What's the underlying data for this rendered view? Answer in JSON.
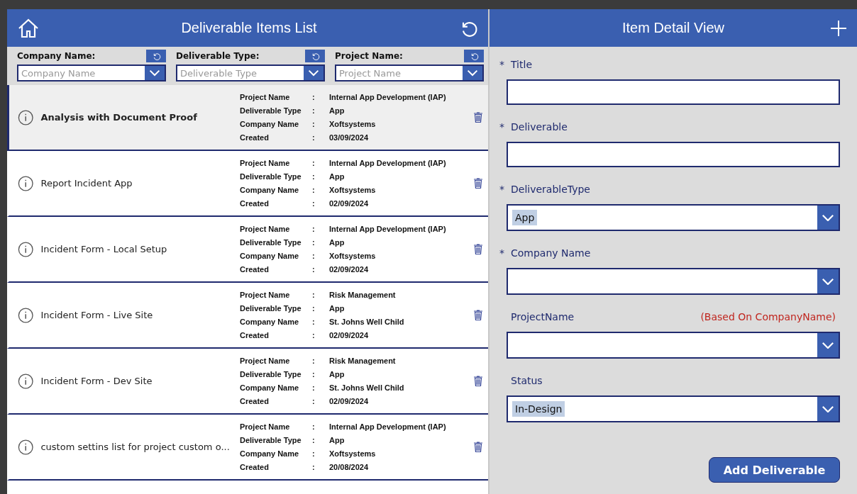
{
  "list_header": {
    "title": "Deliverable Items List"
  },
  "filters": [
    {
      "label": "Company Name:",
      "placeholder": "Company Name"
    },
    {
      "label": "Deliverable Type:",
      "placeholder": "Deliverable Type"
    },
    {
      "label": "Project Name:",
      "placeholder": "Project Name"
    }
  ],
  "items": [
    {
      "title": "Analysis with Document Proof",
      "selected": true,
      "fields": [
        {
          "label": "Project Name",
          "sep": ":",
          "value": "Internal App Development (IAP)"
        },
        {
          "label": "Deliverable Type",
          "sep": ":",
          "value": "App"
        },
        {
          "label": "Company Name",
          "sep": ":",
          "value": "Xoftsystems"
        },
        {
          "label": "Created",
          "sep": ":",
          "value": "03/09/2024"
        }
      ]
    },
    {
      "title": "Report Incident App",
      "selected": false,
      "fields": [
        {
          "label": "Project Name",
          "sep": ":",
          "value": "Internal App Development (IAP)"
        },
        {
          "label": "Deliverable Type",
          "sep": ":",
          "value": "App"
        },
        {
          "label": "Company Name",
          "sep": ":",
          "value": "Xoftsystems"
        },
        {
          "label": "Created",
          "sep": ":",
          "value": "02/09/2024"
        }
      ]
    },
    {
      "title": "Incident Form - Local Setup",
      "selected": false,
      "fields": [
        {
          "label": "Project Name",
          "sep": ":",
          "value": "Internal App Development (IAP)"
        },
        {
          "label": "Deliverable Type",
          "sep": ":",
          "value": "App"
        },
        {
          "label": "Company Name",
          "sep": ":",
          "value": "Xoftsystems"
        },
        {
          "label": "Created",
          "sep": ":",
          "value": "02/09/2024"
        }
      ]
    },
    {
      "title": "Incident Form - Live Site",
      "selected": false,
      "fields": [
        {
          "label": "Project Name",
          "sep": ":",
          "value": "Risk Management"
        },
        {
          "label": "Deliverable Type",
          "sep": ":",
          "value": "App"
        },
        {
          "label": "Company Name",
          "sep": ":",
          "value": "St. Johns Well Child"
        },
        {
          "label": "Created",
          "sep": ":",
          "value": "02/09/2024"
        }
      ]
    },
    {
      "title": "Incident Form - Dev Site",
      "selected": false,
      "fields": [
        {
          "label": "Project Name",
          "sep": ":",
          "value": "Risk Management"
        },
        {
          "label": "Deliverable Type",
          "sep": ":",
          "value": "App"
        },
        {
          "label": "Company Name",
          "sep": ":",
          "value": "St. Johns Well Child"
        },
        {
          "label": "Created",
          "sep": ":",
          "value": "02/09/2024"
        }
      ]
    },
    {
      "title": "custom settins list for project custom o...",
      "selected": false,
      "fields": [
        {
          "label": "Project Name",
          "sep": ":",
          "value": "Internal App Development (IAP)"
        },
        {
          "label": "Deliverable Type",
          "sep": ":",
          "value": "App"
        },
        {
          "label": "Company Name",
          "sep": ":",
          "value": "Xoftsystems"
        },
        {
          "label": "Created",
          "sep": ":",
          "value": "20/08/2024"
        }
      ]
    }
  ],
  "detail_header": {
    "title": "Item Detail View"
  },
  "form": [
    {
      "kind": "text",
      "marker": "*",
      "label": "Title"
    },
    {
      "kind": "text",
      "marker": "*",
      "label": "Deliverable"
    },
    {
      "kind": "dropdown",
      "marker": "*",
      "label": "DeliverableType",
      "value": "App"
    },
    {
      "kind": "dropdown",
      "marker": "*",
      "label": "Company Name"
    },
    {
      "kind": "dropdown",
      "label": "ProjectName",
      "note": "(Based On CompanyName)"
    },
    {
      "kind": "dropdown",
      "label": "Status",
      "value": "In-Design"
    }
  ],
  "submit_button": "Add Deliverable"
}
